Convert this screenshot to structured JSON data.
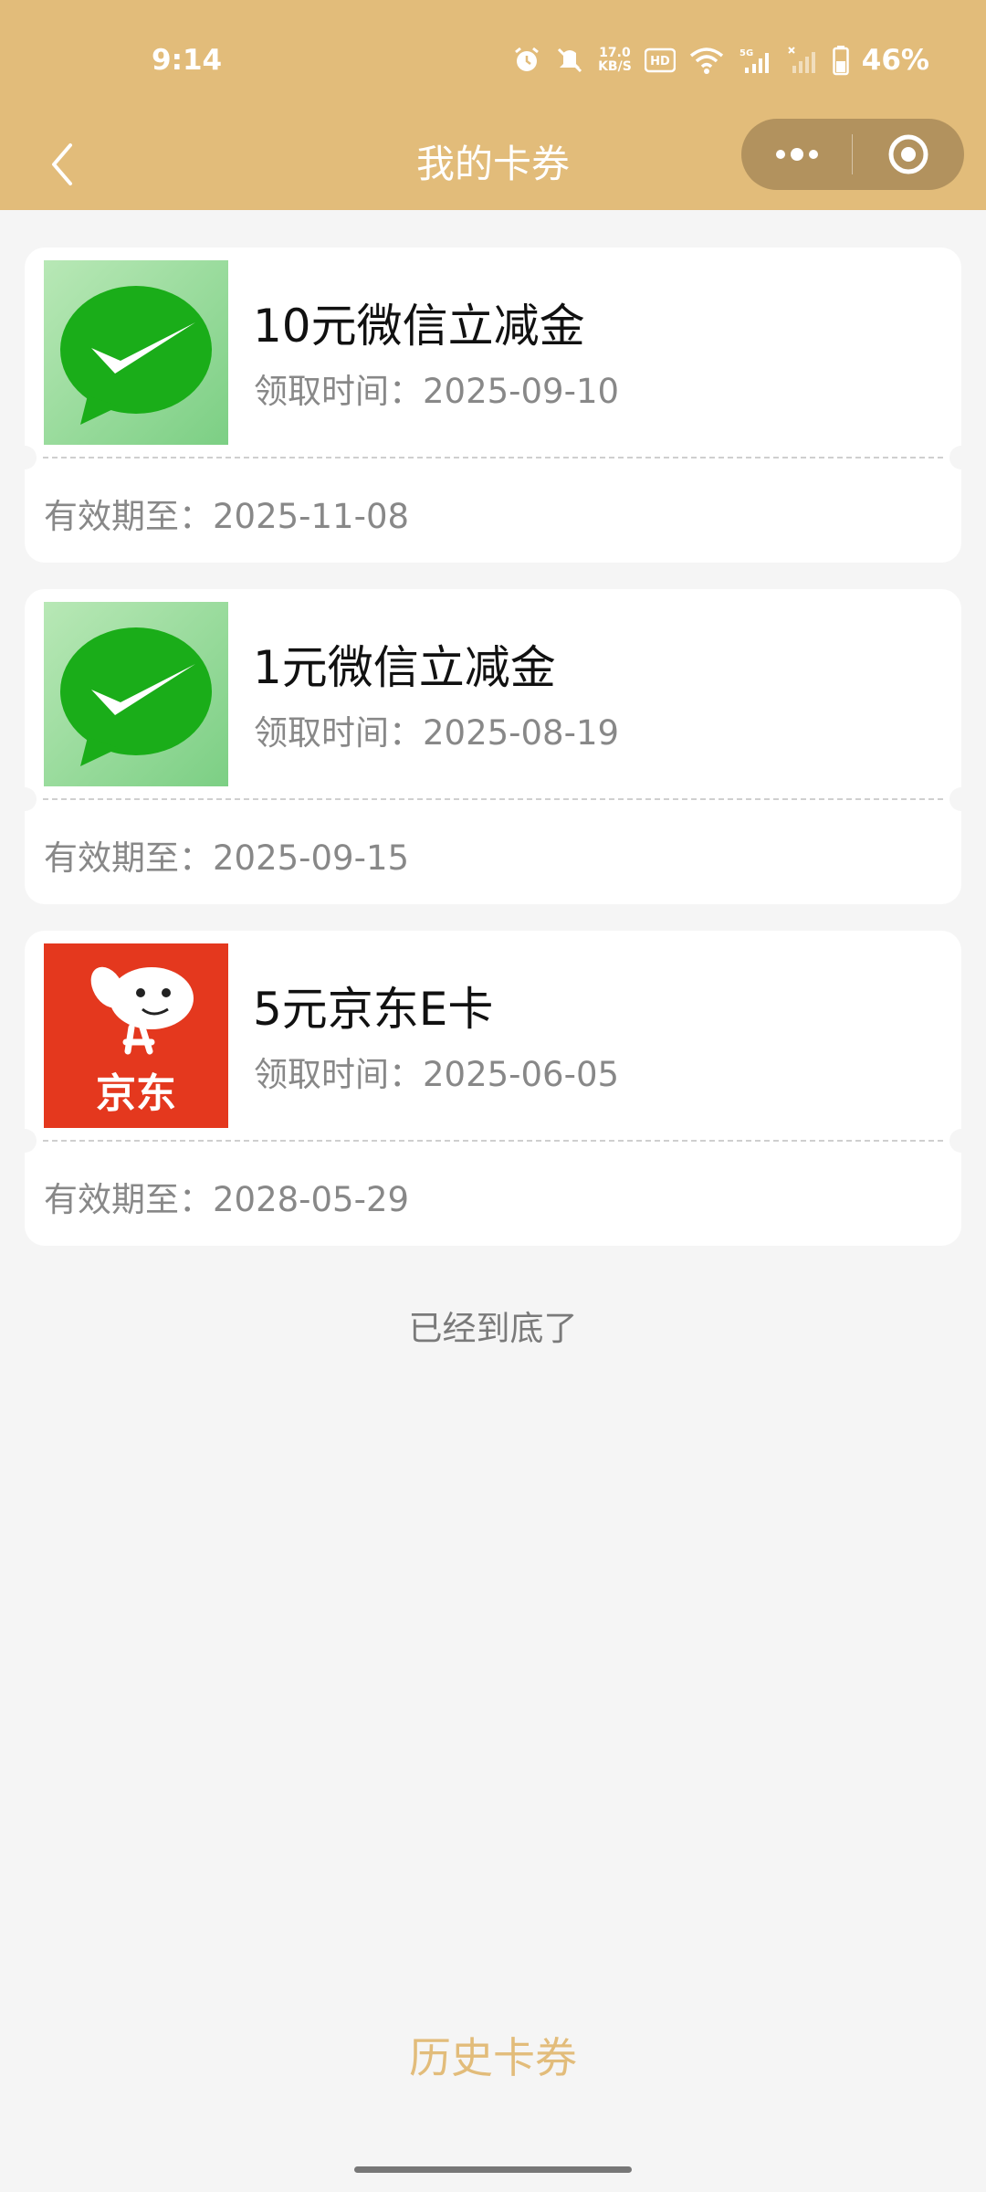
{
  "status_bar": {
    "time": "9:14",
    "net_speed_value": "17.0",
    "net_speed_unit": "KB/S",
    "hd_label": "HD",
    "signal_label": "5G",
    "battery_percent": "46%"
  },
  "nav": {
    "title": "我的卡券"
  },
  "coupons": [
    {
      "title": "10元微信立减金",
      "received": "领取时间：2025-09-10",
      "valid": "有效期至：2025-11-08",
      "icon": "wechat-logo"
    },
    {
      "title": "1元微信立减金",
      "received": "领取时间：2025-08-19",
      "valid": "有效期至：2025-09-15",
      "icon": "wechat-logo"
    },
    {
      "title": "5元京东E卡",
      "received": "领取时间：2025-06-05",
      "valid": "有效期至：2028-05-29",
      "icon": "jd-logo",
      "logo_text": "京东"
    }
  ],
  "end_text": "已经到底了",
  "history_button": "历史卡券",
  "colors": {
    "header": "#e2bc7a",
    "accent": "#e2bc7a",
    "background": "#f5f5f5",
    "wechat_green": "#1aad19",
    "jd_red": "#e4381e"
  }
}
